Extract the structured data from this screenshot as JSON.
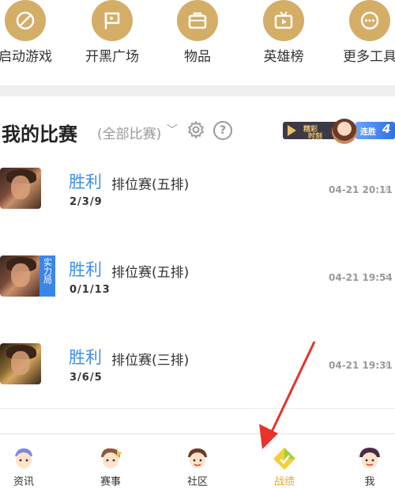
{
  "quick_links": [
    {
      "label": "启动游戏",
      "icon": "game-launch-icon"
    },
    {
      "label": "开黑广场",
      "icon": "flag-icon"
    },
    {
      "label": "物品",
      "icon": "briefcase-icon"
    },
    {
      "label": "英雄榜",
      "icon": "tv-play-icon"
    },
    {
      "label": "更多工具",
      "icon": "more-dots-icon"
    }
  ],
  "matches_header": {
    "title": "我的比赛",
    "filter": "(全部比赛)",
    "help": "?",
    "promo": {
      "line1": "精彩",
      "line2": "时刻",
      "tag": "连胜",
      "count": "4"
    }
  },
  "matches": [
    {
      "result": "胜利",
      "mode": "排位赛(五排)",
      "kda": "2/3/9",
      "time": "04-21 20:11",
      "badge": ""
    },
    {
      "result": "胜利",
      "mode": "排位赛(五排)",
      "kda": "0/1/13",
      "time": "04-21 19:54",
      "badge": "实力局"
    },
    {
      "result": "胜利",
      "mode": "排位赛(三排)",
      "kda": "3/6/5",
      "time": "04-21 19:31",
      "badge": ""
    }
  ],
  "bottom_nav": [
    {
      "label": "资讯",
      "icon": "news-mascot-icon"
    },
    {
      "label": "赛事",
      "icon": "events-mascot-icon"
    },
    {
      "label": "社区",
      "icon": "community-mascot-icon"
    },
    {
      "label": "战绩",
      "icon": "record-diamond-icon",
      "active": true
    },
    {
      "label": "我",
      "icon": "me-avatar-icon"
    }
  ],
  "colors": {
    "gold": "#d4ad67",
    "win_blue": "#3d8ee8",
    "active_nav": "#e4a82a",
    "annotation": "#e8322a"
  }
}
